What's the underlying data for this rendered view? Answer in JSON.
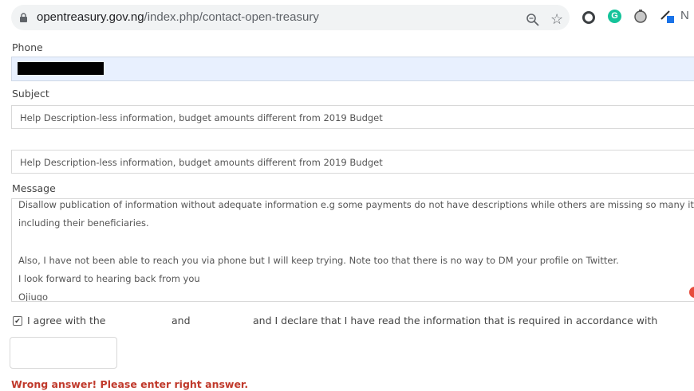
{
  "browser": {
    "url_host": "opentreasury.gov.ng",
    "url_path": "/index.php/contact-open-treasury",
    "extension_g_label": "G",
    "extension_n_label": "N"
  },
  "form": {
    "phone_label": "Phone",
    "subject_label": "Subject",
    "subject_value": "Help Description-less information, budget amounts different from 2019 Budget",
    "subject2_value": "Help Description-less information, budget amounts different from 2019 Budget",
    "message_label": "Message",
    "message_lines": [
      "Disallow publication of information without adequate information e.g some payments do not have descriptions while others are missing so many items",
      "including their beneficiaries.",
      "",
      "Also, I have not been able to reach you via phone but I will keep trying.  Note too that there is no way to DM your profile on Twitter.",
      "I look forward to hearing back from you",
      "Ojiugo"
    ],
    "agree_prefix": "I agree with the",
    "agree_and": "and",
    "agree_suffix": "and I declare that I have read the information that is required in accordance with",
    "error_message": "Wrong answer! Please enter right answer."
  },
  "colors": {
    "error": "#c0392b",
    "autofill_bg": "#e8f0fe",
    "grammarly": "#15c39a"
  }
}
